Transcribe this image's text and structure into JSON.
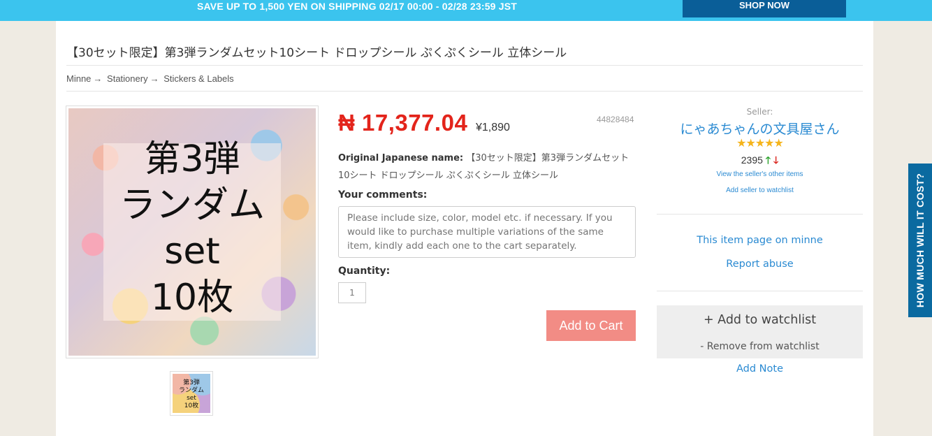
{
  "banner": {
    "text": "SAVE UP TO 1,500 YEN ON SHIPPING 02/17 00:00 - 02/28 23:59 JST",
    "shop_now": "SHOP NOW"
  },
  "product": {
    "title": "【30セット限定】第3弾ランダムセット10シート ドロップシール ぷくぷくシール 立体シール",
    "breadcrumb": [
      "Minne",
      "Stationery",
      "Stickers & Labels"
    ],
    "breadcrumb_separator": "→",
    "image_text": "第3弾 ランダム set 10枚",
    "price": "₦ 17,377.04",
    "price_yen": "¥1,890",
    "item_id": "44828484",
    "original_name_label": "Original Japanese name:",
    "original_name": "【30セット限定】第3弾ランダムセット10シート ドロップシール ぷくぷくシール 立体シール",
    "comments_label": "Your comments:",
    "comments_placeholder": "Please include size, color, model etc. if necessary. If you would like to purchase multiple variations of the same item, kindly add each one to the cart separately.",
    "quantity_label": "Quantity:",
    "quantity_value": "1",
    "add_to_cart": "Add to Cart"
  },
  "seller": {
    "label": "Seller:",
    "name": "にゃあちゃんの文具屋さん",
    "stars": "★★★★★",
    "rating_count": "2395",
    "up_arrow": "🡑",
    "down_arrow": "🡓",
    "other_items": "View the seller's other items",
    "add_watchlist": "Add seller to watchlist"
  },
  "side_links": {
    "item_page": "This item page on minne",
    "report": "Report abuse",
    "add_watch": "+ Add to watchlist",
    "remove_watch": "- Remove from watchlist",
    "add_note": "Add Note"
  },
  "side_tab": "HOW MUCH WILL IT COST?",
  "colors": {
    "banner": "#3bc4ee",
    "price": "#e3241b",
    "cart_button": "#f28c85",
    "link": "#2a8ad2",
    "side_tab": "#0b6aa0"
  }
}
